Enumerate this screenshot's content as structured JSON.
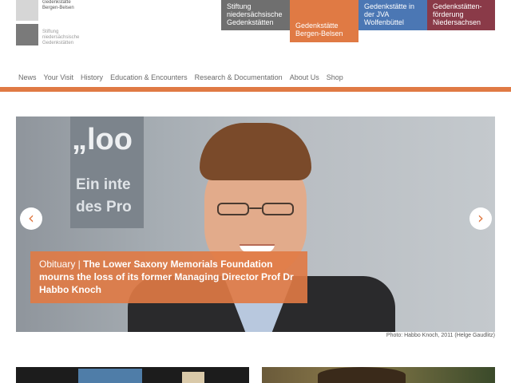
{
  "header": {
    "logo_top_text": "Gedenkstätte\nBergen-Belsen",
    "logo_bottom_text": "Stiftung\nniedersächsische\nGedenkstätten",
    "institutions": [
      {
        "label": "Stiftung niedersächsische Gedenkstätten",
        "color": "#6f6f6f"
      },
      {
        "label": "Gedenkstätte Bergen-Belsen",
        "color": "#e07a44"
      },
      {
        "label": "Gedenkstätte in der JVA Wolfenbüttel",
        "color": "#4b77b4"
      },
      {
        "label": "Gedenkstätten-förderung Niedersachsen",
        "color": "#8a3a48"
      }
    ]
  },
  "nav": {
    "items": [
      "News",
      "Your Visit",
      "History",
      "Education & Encounters",
      "Research & Documentation",
      "About Us",
      "Shop"
    ]
  },
  "hero": {
    "screen_text_line1": "„loo",
    "screen_text_line2": "Ein inte",
    "screen_text_line3": "des Pro",
    "caption_kicker": "Obituary | ",
    "caption_headline": "The Lower Saxony Memorials Foundation mourns the loss of its former Managing Director Prof Dr Habbo Knoch",
    "prev_icon": "chevron-left",
    "next_icon": "chevron-right",
    "photo_credit": "Photo: Habbo Knoch, 2011 (Helge Gaudlitz)"
  },
  "colors": {
    "accent": "#e07a44",
    "grey": "#6f6f6f",
    "blue": "#4b77b4",
    "wine": "#8a3a48"
  }
}
